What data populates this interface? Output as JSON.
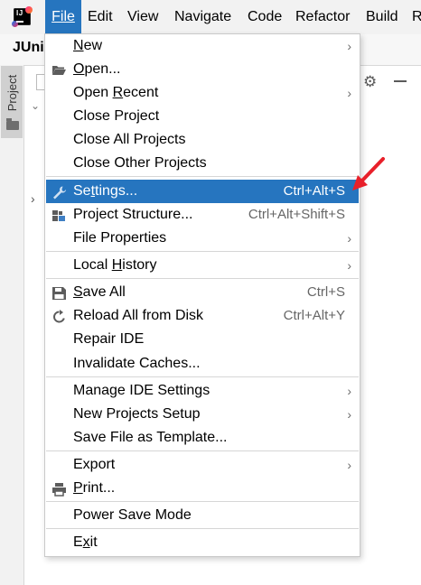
{
  "menubar": {
    "items": [
      {
        "label": "File",
        "mnemonic_first": true
      },
      {
        "label": "Edit",
        "mnemonic_first": true
      },
      {
        "label": "View",
        "mnemonic_first": true
      },
      {
        "label": "Navigate",
        "mnemonic_first": true
      },
      {
        "label": "Code",
        "mnemonic_first": true
      },
      {
        "label": "Refactor",
        "mnemonic_first": true
      },
      {
        "label": "Build",
        "mnemonic_first": true
      },
      {
        "label": "R",
        "mnemonic_first": false
      }
    ],
    "active": "File"
  },
  "project_title": "JUni",
  "side_panel": {
    "tab_label": "Project"
  },
  "file_menu": {
    "items": [
      {
        "pre": "",
        "mn": "N",
        "post": "ew",
        "shortcut": "",
        "submenu": true,
        "icon": ""
      },
      {
        "pre": "",
        "mn": "O",
        "post": "pen...",
        "shortcut": "",
        "submenu": false,
        "icon": "folder-open-icon"
      },
      {
        "pre": "Open ",
        "mn": "R",
        "post": "ecent",
        "shortcut": "",
        "submenu": true,
        "icon": ""
      },
      {
        "pre": "Close Project",
        "mn": "",
        "post": "",
        "shortcut": "",
        "submenu": false,
        "icon": ""
      },
      {
        "pre": "Close All Projects",
        "mn": "",
        "post": "",
        "shortcut": "",
        "submenu": false,
        "icon": ""
      },
      {
        "pre": "Close Other Projects",
        "mn": "",
        "post": "",
        "shortcut": "",
        "submenu": false,
        "icon": ""
      },
      {
        "pre": "Se",
        "mn": "t",
        "post": "tings...",
        "shortcut": "Ctrl+Alt+S",
        "submenu": false,
        "icon": "wrench-icon",
        "highlighted": true
      },
      {
        "pre": "Project Structure...",
        "mn": "",
        "post": "",
        "shortcut": "Ctrl+Alt+Shift+S",
        "submenu": false,
        "icon": "project-structure-icon"
      },
      {
        "pre": "File Properties",
        "mn": "",
        "post": "",
        "shortcut": "",
        "submenu": true,
        "icon": ""
      },
      {
        "pre": "Local ",
        "mn": "H",
        "post": "istory",
        "shortcut": "",
        "submenu": true,
        "icon": ""
      },
      {
        "pre": "",
        "mn": "S",
        "post": "ave All",
        "shortcut": "Ctrl+S",
        "submenu": false,
        "icon": "save-icon"
      },
      {
        "pre": "Reload All from Disk",
        "mn": "",
        "post": "",
        "shortcut": "Ctrl+Alt+Y",
        "submenu": false,
        "icon": "reload-icon"
      },
      {
        "pre": "Repair IDE",
        "mn": "",
        "post": "",
        "shortcut": "",
        "submenu": false,
        "icon": ""
      },
      {
        "pre": "Invalidate Caches...",
        "mn": "",
        "post": "",
        "shortcut": "",
        "submenu": false,
        "icon": ""
      },
      {
        "pre": "Manage IDE Settings",
        "mn": "",
        "post": "",
        "shortcut": "",
        "submenu": true,
        "icon": ""
      },
      {
        "pre": "New Projects Setup",
        "mn": "",
        "post": "",
        "shortcut": "",
        "submenu": true,
        "icon": ""
      },
      {
        "pre": "Save File as Template...",
        "mn": "",
        "post": "",
        "shortcut": "",
        "submenu": false,
        "icon": ""
      },
      {
        "pre": "Export",
        "mn": "",
        "post": "",
        "shortcut": "",
        "submenu": true,
        "icon": ""
      },
      {
        "pre": "",
        "mn": "P",
        "post": "rint...",
        "shortcut": "",
        "submenu": false,
        "icon": "print-icon"
      },
      {
        "pre": "Power Save Mode",
        "mn": "",
        "post": "",
        "shortcut": "",
        "submenu": false,
        "icon": ""
      },
      {
        "pre": "E",
        "mn": "x",
        "post": "it",
        "shortcut": "",
        "submenu": false,
        "icon": ""
      }
    ]
  },
  "colors": {
    "accent": "#2675bf",
    "annotation_arrow": "#e8202a"
  }
}
